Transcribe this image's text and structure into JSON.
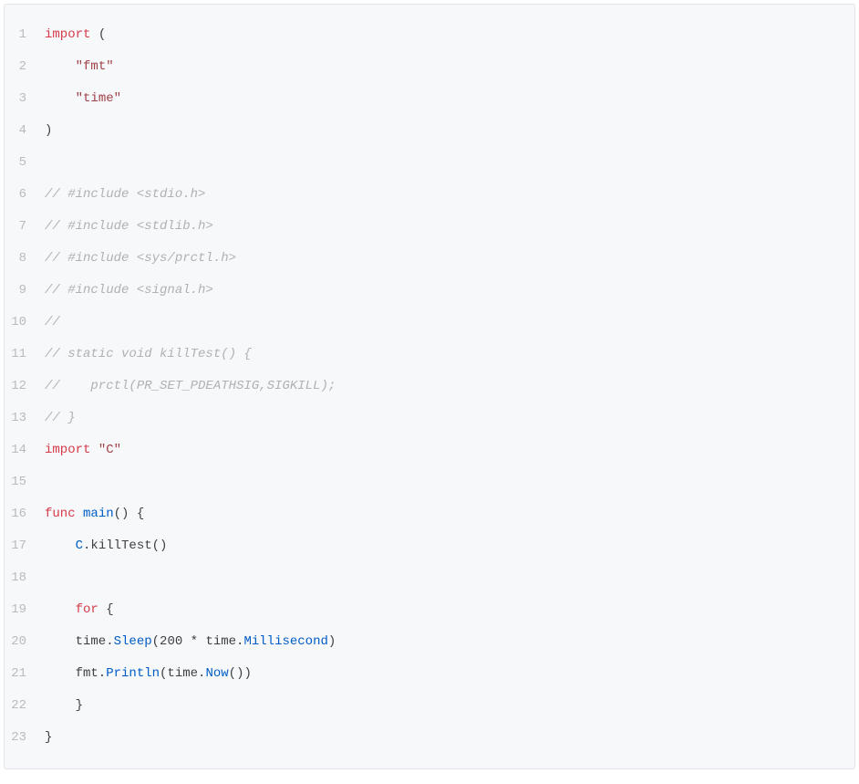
{
  "code": {
    "lines": [
      {
        "num": "1",
        "tokens": [
          {
            "t": "import",
            "c": "tok-keyword"
          },
          {
            "t": " (",
            "c": "tok-plain"
          }
        ]
      },
      {
        "num": "2",
        "tokens": [
          {
            "t": "    ",
            "c": "tok-plain"
          },
          {
            "t": "\"fmt\"",
            "c": "tok-string"
          }
        ]
      },
      {
        "num": "3",
        "tokens": [
          {
            "t": "    ",
            "c": "tok-plain"
          },
          {
            "t": "\"time\"",
            "c": "tok-string"
          }
        ]
      },
      {
        "num": "4",
        "tokens": [
          {
            "t": ")",
            "c": "tok-plain"
          }
        ]
      },
      {
        "num": "5",
        "tokens": []
      },
      {
        "num": "6",
        "tokens": [
          {
            "t": "// #include <stdio.h>",
            "c": "tok-comment"
          }
        ]
      },
      {
        "num": "7",
        "tokens": [
          {
            "t": "// #include <stdlib.h>",
            "c": "tok-comment"
          }
        ]
      },
      {
        "num": "8",
        "tokens": [
          {
            "t": "// #include <sys/prctl.h>",
            "c": "tok-comment"
          }
        ]
      },
      {
        "num": "9",
        "tokens": [
          {
            "t": "// #include <signal.h>",
            "c": "tok-comment"
          }
        ]
      },
      {
        "num": "10",
        "tokens": [
          {
            "t": "//",
            "c": "tok-comment"
          }
        ]
      },
      {
        "num": "11",
        "tokens": [
          {
            "t": "// static void killTest() {",
            "c": "tok-comment"
          }
        ]
      },
      {
        "num": "12",
        "tokens": [
          {
            "t": "//    prctl(PR_SET_PDEATHSIG,SIGKILL);",
            "c": "tok-comment"
          }
        ]
      },
      {
        "num": "13",
        "tokens": [
          {
            "t": "// }",
            "c": "tok-comment"
          }
        ]
      },
      {
        "num": "14",
        "tokens": [
          {
            "t": "import",
            "c": "tok-keyword"
          },
          {
            "t": " ",
            "c": "tok-plain"
          },
          {
            "t": "\"C\"",
            "c": "tok-string"
          }
        ]
      },
      {
        "num": "15",
        "tokens": []
      },
      {
        "num": "16",
        "tokens": [
          {
            "t": "func",
            "c": "tok-keyword"
          },
          {
            "t": " ",
            "c": "tok-plain"
          },
          {
            "t": "main",
            "c": "tok-func"
          },
          {
            "t": "() {",
            "c": "tok-plain"
          }
        ]
      },
      {
        "num": "17",
        "tokens": [
          {
            "t": "    ",
            "c": "tok-plain"
          },
          {
            "t": "C",
            "c": "tok-func"
          },
          {
            "t": ".killTest()",
            "c": "tok-plain"
          }
        ]
      },
      {
        "num": "18",
        "tokens": []
      },
      {
        "num": "19",
        "tokens": [
          {
            "t": "    ",
            "c": "tok-plain"
          },
          {
            "t": "for",
            "c": "tok-keyword"
          },
          {
            "t": " {",
            "c": "tok-plain"
          }
        ]
      },
      {
        "num": "20",
        "tokens": [
          {
            "t": "    time.",
            "c": "tok-plain"
          },
          {
            "t": "Sleep",
            "c": "tok-func"
          },
          {
            "t": "(200 * time.",
            "c": "tok-plain"
          },
          {
            "t": "Millisecond",
            "c": "tok-func"
          },
          {
            "t": ")",
            "c": "tok-plain"
          }
        ]
      },
      {
        "num": "21",
        "tokens": [
          {
            "t": "    fmt.",
            "c": "tok-plain"
          },
          {
            "t": "Println",
            "c": "tok-func"
          },
          {
            "t": "(time.",
            "c": "tok-plain"
          },
          {
            "t": "Now",
            "c": "tok-func"
          },
          {
            "t": "())",
            "c": "tok-plain"
          }
        ]
      },
      {
        "num": "22",
        "tokens": [
          {
            "t": "    }",
            "c": "tok-plain"
          }
        ]
      },
      {
        "num": "23",
        "tokens": [
          {
            "t": "}",
            "c": "tok-plain"
          }
        ]
      }
    ]
  }
}
